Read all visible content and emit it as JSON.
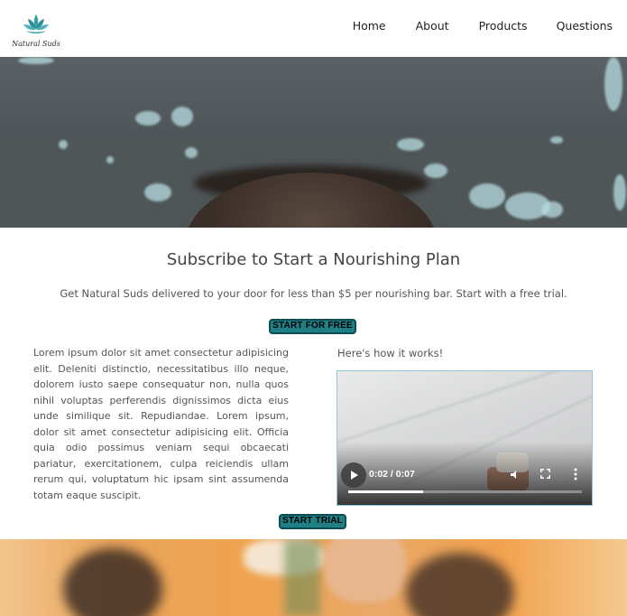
{
  "header": {
    "logo_text": "Natural Suds",
    "nav": [
      "Home",
      "About",
      "Products",
      "Questions"
    ]
  },
  "subscribe": {
    "title": "Subscribe to Start a Nourishing Plan",
    "text": "Get Natural Suds delivered to your door for less than $5 per nourishing bar. Start with a free trial.",
    "cta_free": "START FOR FREE",
    "body": "Lorem ipsum dolor sit amet consectetur adipisicing elit. Deleniti distinctio, necessitatibus illo neque, dolorem iusto saepe consequatur non, nulla quos nihil voluptas perferendis dignissimos dicta eius unde similique sit. Repudiandae. Lorem ipsum, dolor sit amet consectetur adipisicing elit. Officia quia odio possimus veniam sequi obcaecati pariatur, exercitationem, culpa reiciendis ullam rerum qui, voluptatum hic ipsam sint assumenda totam eaque suscipit.",
    "how_label": "Here's how it works!",
    "cta_trial": "START TRIAL"
  },
  "video": {
    "time": "0:02 / 0:07",
    "progress": 0.32
  },
  "colors": {
    "button_bg": "#1f7f84",
    "logo": "#3aa0a8"
  }
}
